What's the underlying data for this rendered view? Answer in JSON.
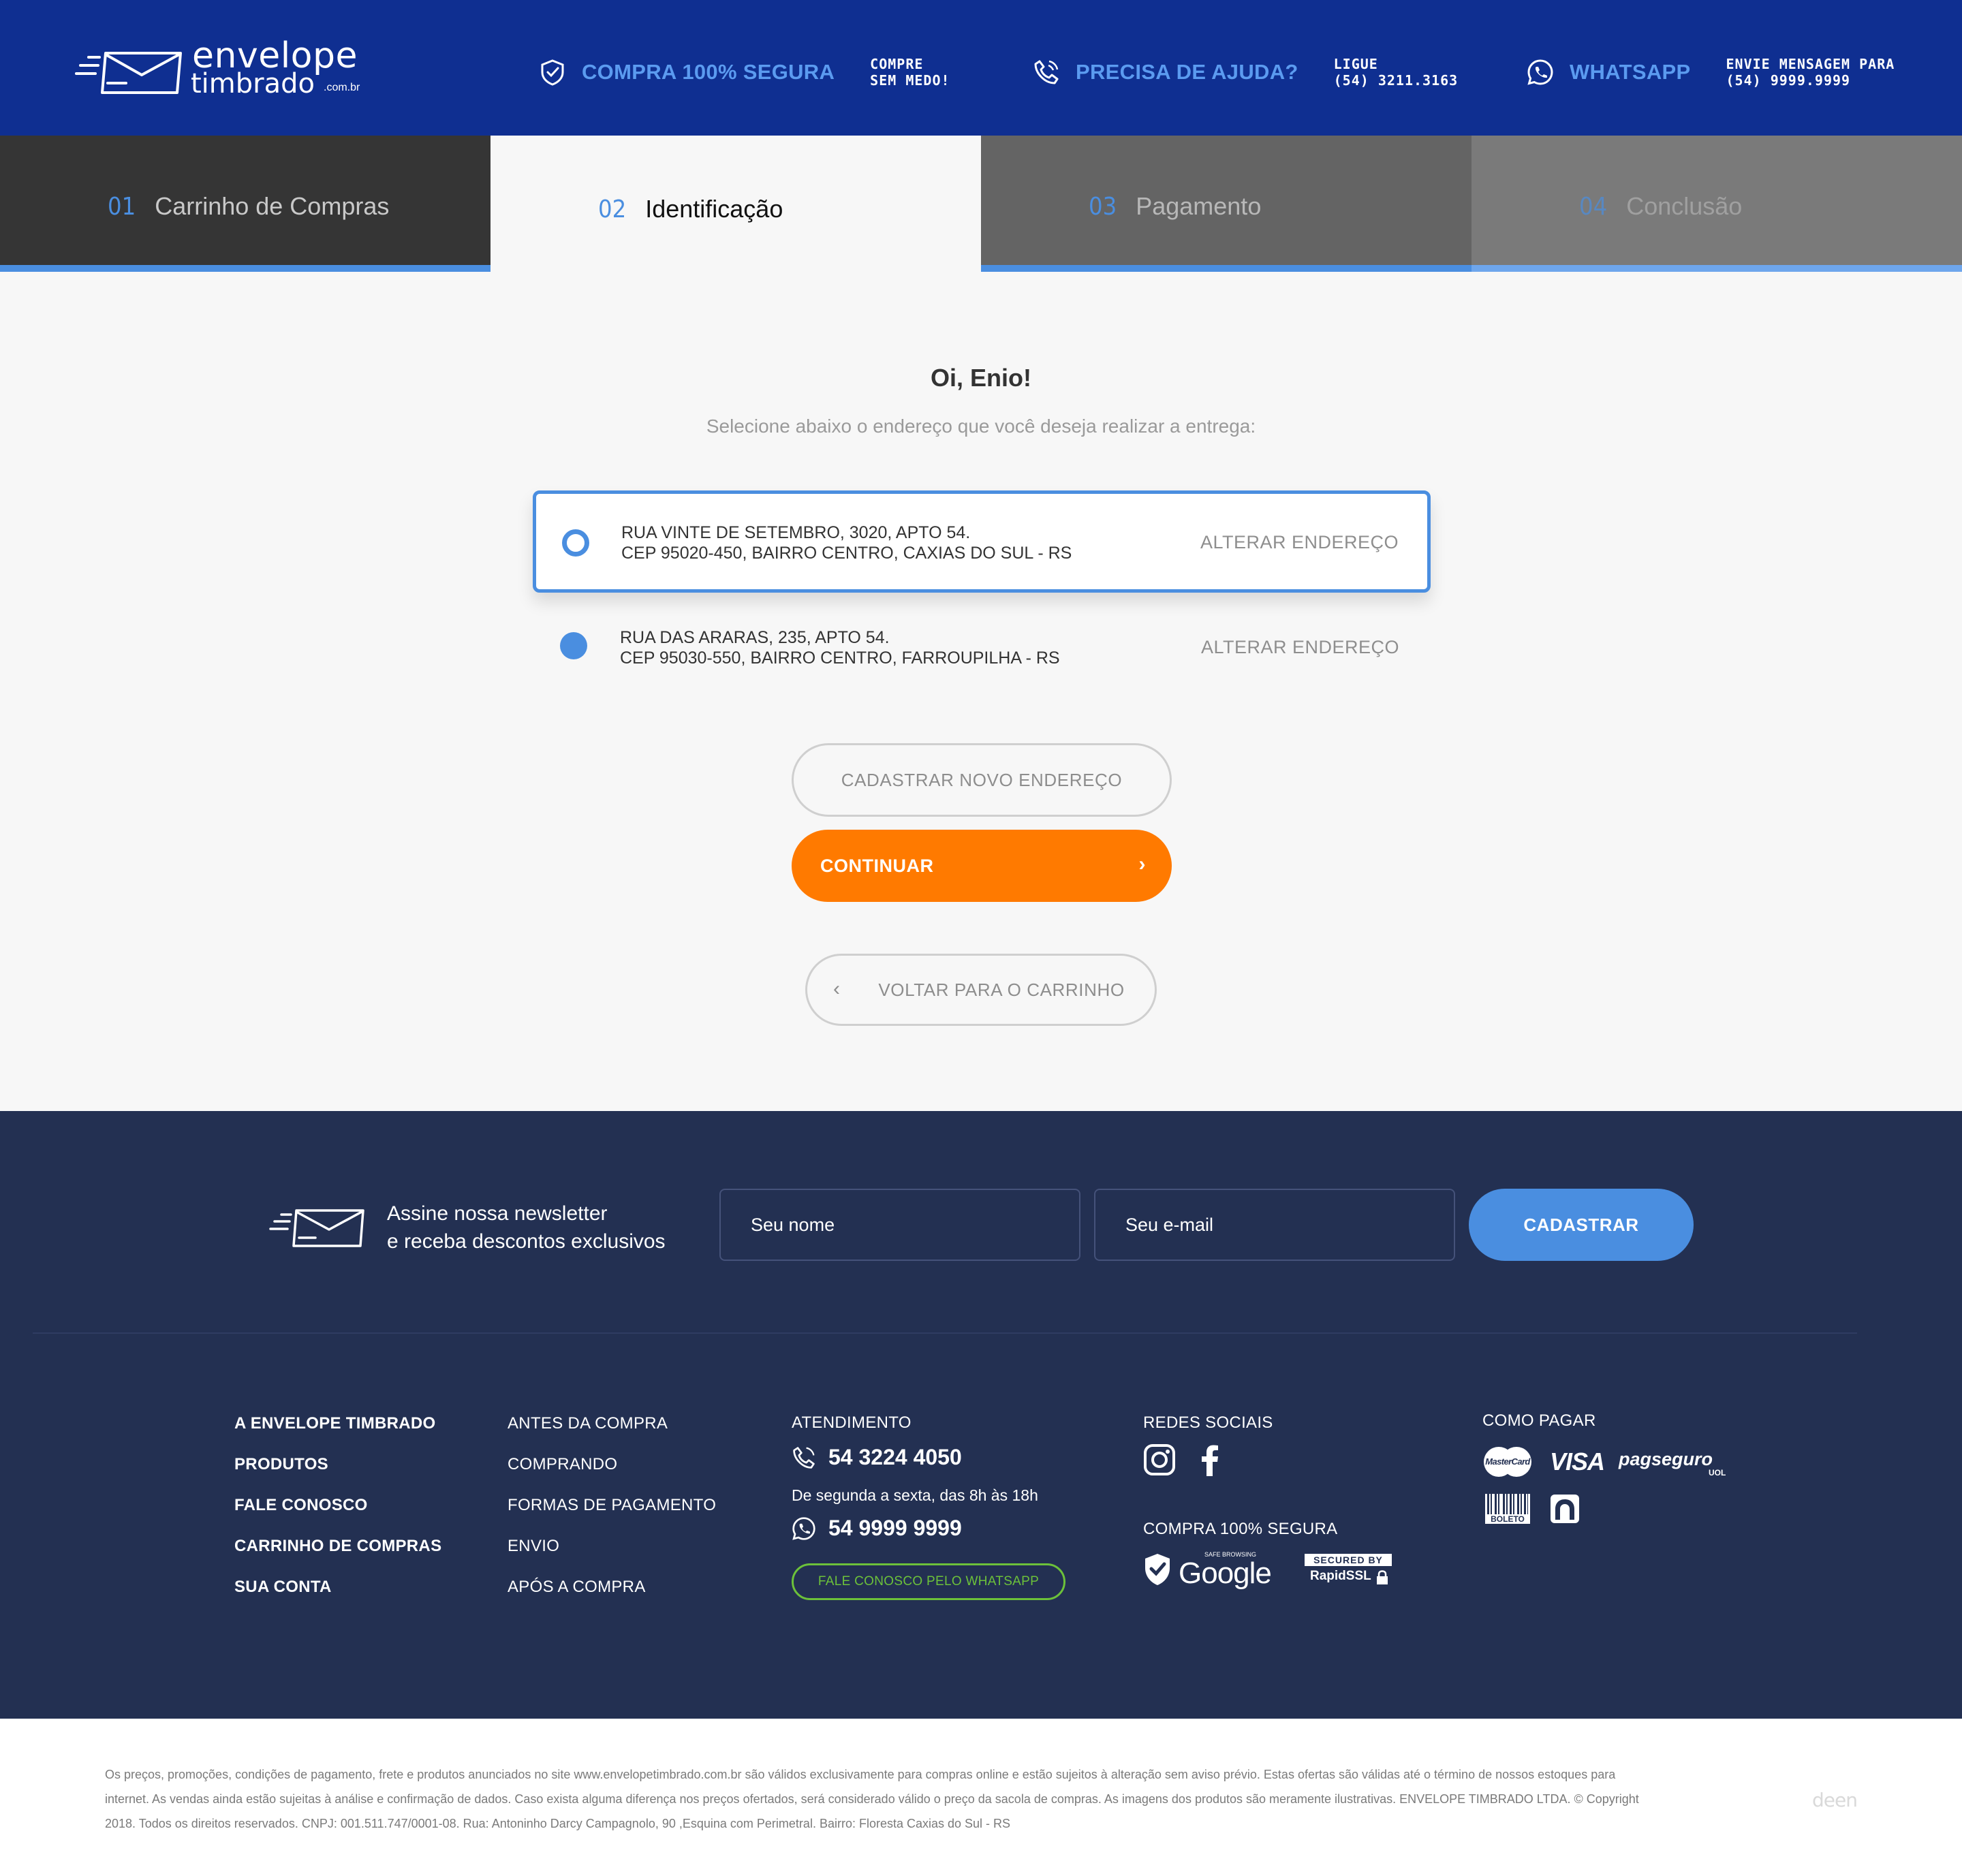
{
  "header": {
    "logo": {
      "line1": "envelope",
      "line2": "timbrado",
      "tld": ".com.br"
    },
    "items": [
      {
        "title": "COMPRA 100% SEGURA",
        "sub1": "COMPRE",
        "sub2": "SEM MEDO!",
        "icon": "shield-check-icon"
      },
      {
        "title": "PRECISA DE AJUDA?",
        "sub1": "LIGUE",
        "sub2": "(54) 3211.3163",
        "icon": "phone-icon"
      },
      {
        "title": "WHATSAPP",
        "sub1": "ENVIE MENSAGEM PARA",
        "sub2": "(54) 9999.9999",
        "icon": "whatsapp-icon"
      }
    ]
  },
  "steps": [
    {
      "num": "01",
      "label": "Carrinho de Compras",
      "state": "done"
    },
    {
      "num": "02",
      "label": "Identificação",
      "state": "active"
    },
    {
      "num": "03",
      "label": "Pagamento",
      "state": "pending"
    },
    {
      "num": "04",
      "label": "Conclusão",
      "state": "pending"
    }
  ],
  "main": {
    "greeting": "Oi, Enio!",
    "subtitle": "Selecione abaixo o endereço que você deseja realizar a entrega:",
    "addresses": [
      {
        "line1": "RUA VINTE DE SETEMBRO, 3020, APTO 54.",
        "line2": "CEP 95020-450, BAIRRO CENTRO, CAXIAS DO SUL - RS",
        "action": "ALTERAR ENDEREÇO",
        "selected": true
      },
      {
        "line1": "RUA DAS ARARAS, 235, APTO 54.",
        "line2": "CEP 95030-550, BAIRRO CENTRO, FARROUPILHA - RS",
        "action": "ALTERAR ENDEREÇO",
        "selected": false
      }
    ],
    "new_address_label": "CADASTRAR NOVO ENDEREÇO",
    "continue_label": "CONTINUAR",
    "back_label": "VOLTAR PARA O CARRINHO"
  },
  "newsletter": {
    "line1": "Assine nossa newsletter",
    "line2": "e receba descontos exclusivos",
    "name_placeholder": "Seu nome",
    "email_placeholder": "Seu e-mail",
    "submit_label": "CADASTRAR"
  },
  "footer": {
    "col1": [
      "A ENVELOPE TIMBRADO",
      "PRODUTOS",
      "FALE CONOSCO",
      "CARRINHO DE COMPRAS",
      "SUA CONTA"
    ],
    "col2": [
      "ANTES DA COMPRA",
      "COMPRANDO",
      "FORMAS DE PAGAMENTO",
      "ENVIO",
      "APÓS A COMPRA"
    ],
    "service": {
      "heading": "ATENDIMENTO",
      "phone": "54 3224 4050",
      "hours": "De segunda a sexta, das 8h às 18h",
      "whatsapp": "54 9999 9999",
      "whatsapp_button": "FALE CONOSCO PELO WHATSAPP"
    },
    "social": {
      "heading": "REDES SOCIAIS",
      "icons": [
        "instagram-icon",
        "facebook-icon"
      ]
    },
    "security": {
      "heading": "COMPRA 100% SEGURA",
      "google_small": "SAFE BROWSING",
      "google": "Google",
      "rapid_top": "SECURED BY",
      "rapid": "RapidSSL"
    },
    "payment": {
      "heading": "COMO PAGAR",
      "mastercard": "MasterCard",
      "visa": "VISA",
      "pagseguro": "pagseguro",
      "pagseguro_sub": "UOL",
      "boleto": "BOLETO"
    }
  },
  "legal": {
    "text": "Os preços, promoções, condições de pagamento, frete e produtos anunciados no site www.envelopetimbrado.com.br são válidos exclusivamente para compras online e estão sujeitos à alteração sem aviso prévio. Estas ofertas são válidas até o término de nossos estoques para internet.  As vendas ainda estão sujeitas à análise e confirmação de dados. Caso exista alguma diferença nos preços ofertados, será considerado válido o preço da sacola de compras. As imagens dos produtos são meramente ilustrativas.  ENVELOPE TIMBRADO LTDA. © Copyright 2018. Todos os direitos reservados. CNPJ: 001.511.747/0001-08. Rua: Antoninho Darcy Campagnolo, 90 ,Esquina com Perimetral. Bairro: Floresta Caxias do Sul - RS",
    "credit": "deen"
  },
  "colors": {
    "header_bg": "#0f2f91",
    "accent_blue": "#4a8ee0",
    "cta_orange": "#ff7a00",
    "footer_bg": "#233052",
    "whatsapp_green": "#6cc13a"
  }
}
